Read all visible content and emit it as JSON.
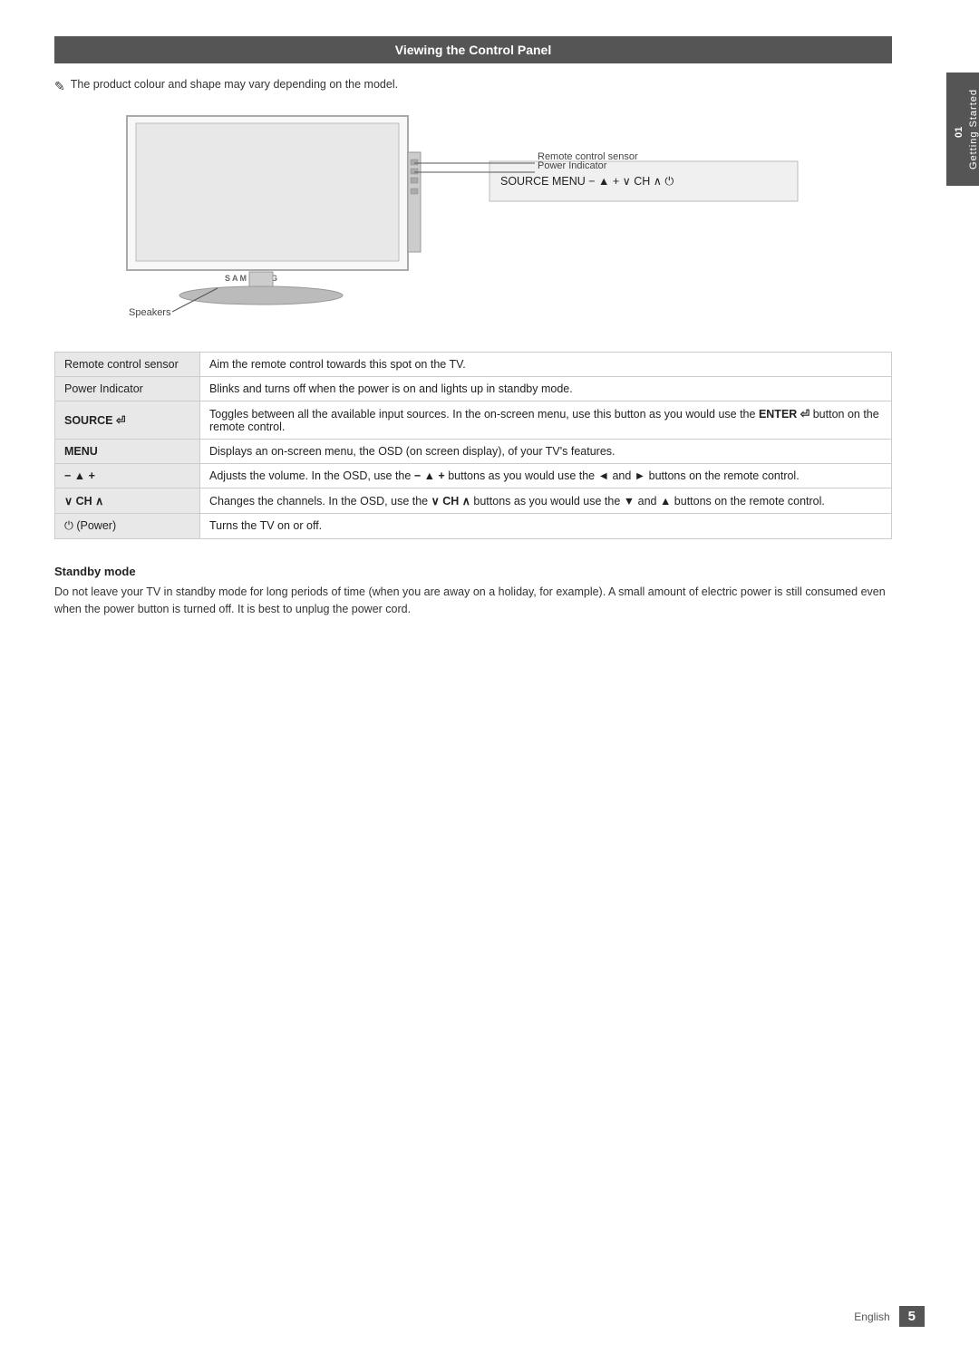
{
  "page": {
    "title": "Viewing the Control Panel",
    "note": "The product colour and shape may vary depending on the model.",
    "side_tab": {
      "number": "01",
      "text": "Getting Started"
    },
    "footer": {
      "lang": "English",
      "page": "5"
    }
  },
  "diagram": {
    "labels": {
      "remote_sensor_line": "Remote control sensor",
      "power_indicator_line": "Power Indicator",
      "speakers": "Speakers",
      "brand": "SAMSUNG"
    },
    "control_panel": {
      "buttons": "SOURCE    MENU  −  ▲ +   ∨ CH ∧   ⏻"
    }
  },
  "table": {
    "rows": [
      {
        "label": "Remote control sensor",
        "description": "Aim the remote control towards this spot on the TV."
      },
      {
        "label": "Power Indicator",
        "description": "Blinks and turns off when the power is on and lights up in standby mode."
      },
      {
        "label": "SOURCE",
        "description": "Toggles between all the available input sources. In the on-screen menu, use this button as you would use the ENTER  button on the remote control.",
        "bold": true
      },
      {
        "label": "MENU",
        "description": "Displays an on-screen menu, the OSD (on screen display), of your TV's features.",
        "bold": true
      },
      {
        "label": "− ▲ +",
        "description": "Adjusts the volume. In the OSD, use the − ▲ + buttons as you would use the ◄ and ► buttons on the remote control.",
        "bold": true
      },
      {
        "label": "∨ CH ∧",
        "description": "Changes the channels. In the OSD, use the ∨ CH ∧ buttons as you would use the ▼ and ▲ buttons on the remote control.",
        "bold": true
      },
      {
        "label": "⏻ (Power)",
        "description": "Turns the TV on or off."
      }
    ]
  },
  "standby": {
    "title": "Standby mode",
    "text": "Do not leave your TV in standby mode for long periods of time (when you are away on a holiday, for example). A small amount of electric power is still consumed even when the power button is turned off. It is best to unplug the power cord."
  }
}
